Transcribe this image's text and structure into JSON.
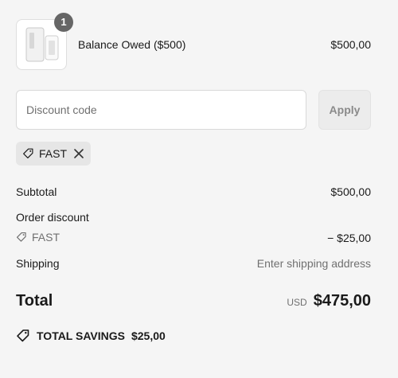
{
  "line_item": {
    "quantity": "1",
    "name": "Balance Owed ($500)",
    "price": "$500,00",
    "image_icon": "product-thumbnail"
  },
  "discount": {
    "placeholder": "Discount code",
    "apply_label": "Apply",
    "applied_code": "FAST"
  },
  "summary": {
    "subtotal_label": "Subtotal",
    "subtotal_value": "$500,00",
    "order_discount_label": "Order discount",
    "discount_code": "FAST",
    "discount_value": "− $25,00",
    "shipping_label": "Shipping",
    "shipping_value": "Enter shipping address",
    "total_label": "Total",
    "currency": "USD",
    "total_value": "$475,00"
  },
  "savings": {
    "label": "TOTAL SAVINGS",
    "value": "$25,00"
  },
  "colors": {
    "background": "#f5f5f5",
    "badge": "#666666",
    "muted_text": "#707070"
  }
}
